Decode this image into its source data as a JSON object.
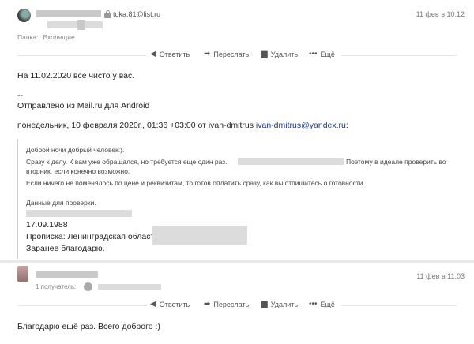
{
  "message1": {
    "sender_email": "toka.81@list.ru",
    "date": "11 фев в 10:12",
    "folder_label": "Папка:",
    "folder_value": "Входящие",
    "actions": {
      "reply": "Ответить",
      "forward": "Переслать",
      "delete": "Удалить",
      "more": "Ещё"
    },
    "body": {
      "line1": "На 11.02.2020 все чисто у вас.",
      "sig_dash": "--",
      "sig": "Отправлено из Mail.ru для Android",
      "quote_header_prefix": "понедельник, 10 февраля 2020г., 01:36 +03:00 от ivan-dmitrus ",
      "quote_header_link": "ivan-dmitrus@yandex.ru",
      "quote_header_suffix": ":"
    },
    "quote": {
      "l1": "Доброй ночи добрый человек:).",
      "l2a": "Сразу к делу. К вам уже обращался, но требуется еще один раз.",
      "l2b": "Поэтому в идеале проверить во",
      "l3": "вторник, если конечно возможно.",
      "l4": "Если ничего не поменялось по цене и реквизитам, то готов оплатить сразу, как вы отпишитесь о готовности.",
      "l5": "Данные для проверки.",
      "birth": "17.09.1988",
      "registration": "Прописка: Ленинградская область",
      "thanks": "Заранее благодарю."
    }
  },
  "message2": {
    "date": "11 фев в 11:03",
    "recipients": "1 получатель:",
    "actions": {
      "reply": "Ответить",
      "forward": "Переслать",
      "delete": "Удалить",
      "more": "Ещё"
    },
    "body": "Благодарю ещё раз. Всего доброго :)"
  },
  "icons": {
    "reply": "reply-arrow-icon",
    "forward": "forward-arrow-icon",
    "delete": "trash-icon",
    "more": "more-dots-icon",
    "lock": "lock-icon"
  }
}
